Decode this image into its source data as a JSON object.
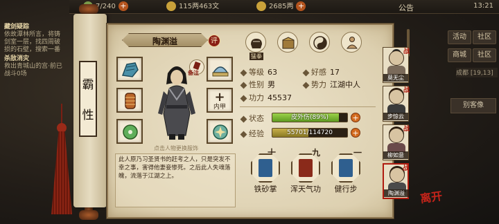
{
  "topbar": {
    "resource1": "7/240",
    "resource2": "115两463文",
    "resource3": "2685两",
    "notice": "公告",
    "time": "13:21"
  },
  "quests": [
    {
      "title": "藏剑疑踪",
      "desc": "依故潭林所言，将铸剑室一层，找四周破损的石壁，搜索一番"
    },
    {
      "title": "杀敌消灾",
      "desc": "救出青城山的宫·前已战斗0场"
    }
  ],
  "side": {
    "btn_activity": "活动",
    "btn_community": "社区",
    "btn_shop": "商城",
    "btn_community2": "社区",
    "location": "成都",
    "coords": "[19,13]",
    "btn_bieke": "别客像"
  },
  "character": {
    "name_vertical": [
      "霸",
      "性"
    ],
    "name": "陶渊溢",
    "eval_label": "评",
    "note_label": "备注",
    "hint": "点击人物更换服饰",
    "armor_label": "内甲",
    "topic_tag": "猛拳"
  },
  "stats": {
    "level_key": "等级",
    "level_val": "63",
    "favor_key": "好感",
    "favor_val": "17",
    "gender_key": "性别",
    "gender_val": "男",
    "faction_key": "势力",
    "faction_val": "江湖中人",
    "power_key": "功力",
    "power_val": "45537",
    "status_key": "状态",
    "status_text": "皮外伤(89%)",
    "status_ratio": 0.89,
    "exp_key": "经验",
    "exp_text": "55701/114720",
    "exp_ratio": 0.4855
  },
  "description": "此人原乃习圣贤书的赶考之人，只是突发不幸之事，害得他妻妾惨死。之后此人失魂落魄，流落于江湖之上。",
  "skills": [
    {
      "rank": "十",
      "name": "铁砂掌",
      "color": "#2f5f8f"
    },
    {
      "rank": "九",
      "name": "浑天气功",
      "color": "#8a2a1a"
    },
    {
      "rank": "一",
      "name": "健行步",
      "color": "#2f5f8f"
    }
  ],
  "party": [
    {
      "name": "莫无尘",
      "tag": "战"
    },
    {
      "name": "步惊云",
      "tag": "战"
    },
    {
      "name": "柳如意",
      "tag": "战"
    },
    {
      "name": "陶渊溢",
      "tag": "战"
    }
  ],
  "leave_label": "离开"
}
